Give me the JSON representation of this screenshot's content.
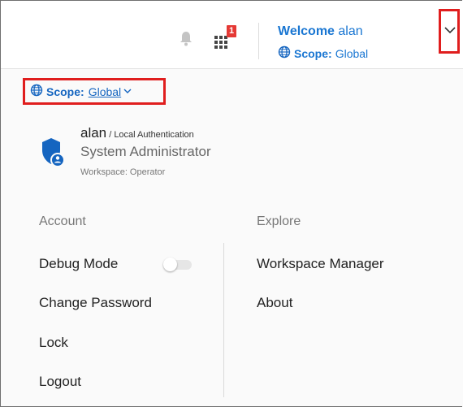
{
  "header": {
    "welcome_prefix": "Welcome",
    "username": "alan",
    "scope_label": "Scope:",
    "scope_value": "Global",
    "notification_count": "1",
    "icons": [
      "bell-icon",
      "apps-grid-icon",
      "globe-icon",
      "chevron-down-icon"
    ]
  },
  "panel": {
    "scope": {
      "label": "Scope:",
      "value": "Global"
    },
    "user": {
      "name": "alan",
      "separator": " / ",
      "auth": "Local Authentication",
      "role": "System Administrator",
      "workspace": "Workspace: Operator"
    },
    "account": {
      "title": "Account",
      "items": [
        "Debug Mode",
        "Change Password",
        "Lock",
        "Logout"
      ],
      "debug_mode_enabled": false
    },
    "explore": {
      "title": "Explore",
      "items": [
        "Workspace Manager",
        "About"
      ]
    }
  },
  "colors": {
    "accent": "#1976d2",
    "highlight_border": "#e01e1e",
    "badge": "#e53935"
  }
}
